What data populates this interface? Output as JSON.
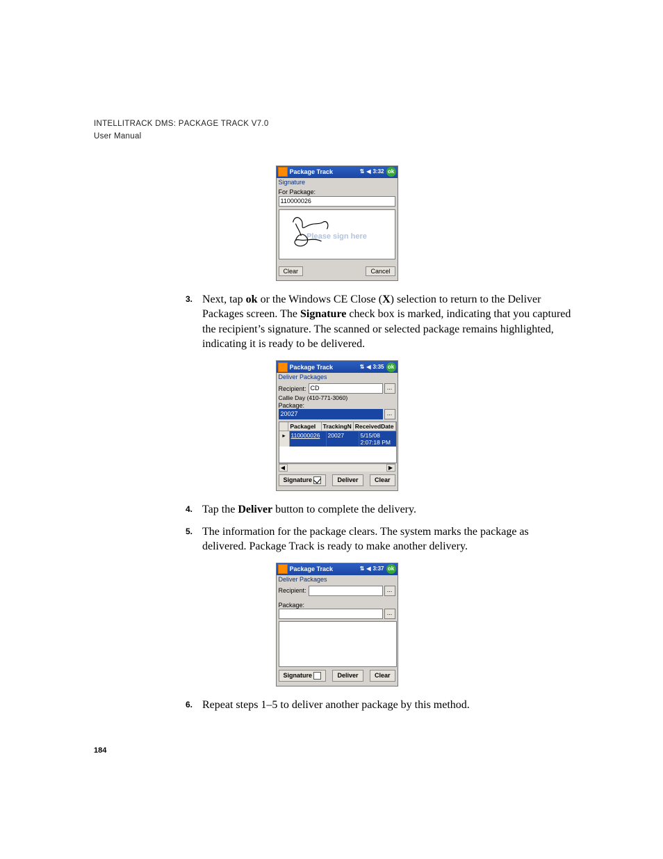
{
  "header": {
    "line1_a": "I",
    "line1_b": "NTELLI",
    "line1_c": "T",
    "line1_d": "RACK",
    "line1_e": " DMS: P",
    "line1_f": "ACKAGE",
    "line1_g": " T",
    "line1_h": "RACK V",
    "line1_i": "7.0",
    "line2": "User Manual"
  },
  "shot1": {
    "app_title": "Package Track",
    "clock": "3:32",
    "subtitle": "Signature",
    "for_label": "For Package:",
    "for_value": "110000026",
    "sign_ghost": "Please sign here",
    "clear_btn": "Clear",
    "cancel_btn": "Cancel"
  },
  "step3": {
    "num": "3",
    "pre": "Next, tap ",
    "ok": "ok",
    "mid1": " or the Windows CE Close (",
    "x": "X",
    "mid2": ") selection to return to the Deliver Packages screen. The ",
    "sig": "Signature",
    "tail": " check box is marked, indicating that you captured the recipient’s signature. The scanned or selected package remains highlighted, indicating it is ready to be delivered."
  },
  "shot2": {
    "app_title": "Package Track",
    "clock": "3:35",
    "subtitle": "Deliver Packages",
    "recipient_label": "Recipient:",
    "recipient_value": "CD",
    "recipient_info": "Callie Day (410-771-3060)",
    "package_label": "Package:",
    "package_value": "20027",
    "th_pkg": "PackageI",
    "th_trk": "TrackingN",
    "th_date": "ReceivedDate",
    "row_pkg": "110000026",
    "row_trk": "20027",
    "row_date": "5/15/08 2:07:18 PM",
    "sig_btn": "Signature",
    "deliver_btn": "Deliver",
    "clear_btn": "Clear"
  },
  "step4": {
    "num": "4",
    "pre": "Tap the ",
    "btn": "Deliver",
    "tail": " button to complete the delivery."
  },
  "step5": {
    "num": "5",
    "text": "The information for the package clears. The system marks the package as delivered. Package Track is ready to make another delivery."
  },
  "shot3": {
    "app_title": "Package Track",
    "clock": "3:37",
    "subtitle": "Deliver Packages",
    "recipient_label": "Recipient:",
    "package_label": "Package:",
    "sig_btn": "Signature",
    "deliver_btn": "Deliver",
    "clear_btn": "Clear"
  },
  "step6": {
    "num": "6",
    "text": "Repeat steps 1–5 to deliver another package by this method."
  },
  "page_number": "184",
  "icons": {
    "ok_text": "ok",
    "net": "⇅",
    "sound": "◀",
    "ellipsis": "...",
    "row_marker": "▸",
    "scroll_left": "◀",
    "scroll_right": "▶"
  }
}
